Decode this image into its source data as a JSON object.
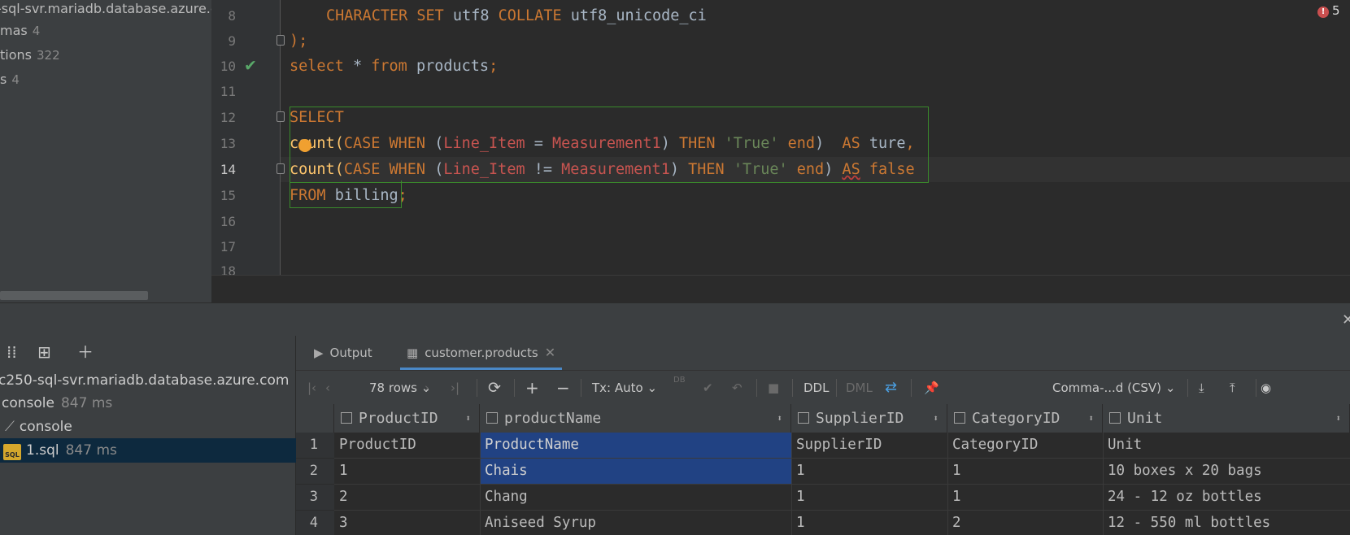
{
  "tree": {
    "items": [
      {
        "label": "-sql-svr.mariadb.database.azure.c",
        "count": ""
      },
      {
        "label": "mas",
        "count": "4"
      },
      {
        "label": "tions",
        "count": "322"
      },
      {
        "label": "s",
        "count": "4"
      }
    ]
  },
  "editor": {
    "error_count": "5",
    "line_numbers": [
      "8",
      "9",
      "10",
      "11",
      "12",
      "13",
      "14",
      "15",
      "16",
      "17",
      "18"
    ],
    "code": {
      "l8_a": "CHARACTER SET",
      "l8_b": " utf8 ",
      "l8_c": "COLLATE",
      "l8_d": " utf8_unicode_ci",
      "l9": ");",
      "l10_a": "select",
      "l10_b": " * ",
      "l10_c": "from",
      "l10_d": " products",
      "l10_e": ";",
      "l12": "SELECT",
      "l13_a": "count(",
      "l13_b": "CASE WHEN",
      "l13_c": " (",
      "l13_d": "Line_Item",
      "l13_e": " = ",
      "l13_f": "Measurement1",
      "l13_g": ") ",
      "l13_h": "THEN",
      "l13_i": " ",
      "l13_j": "'True'",
      "l13_k": " ",
      "l13_l": "end",
      "l13_m": ")  ",
      "l13_n": "AS",
      "l13_o": " ture",
      "l13_p": ",",
      "l14_a": "count(",
      "l14_b": "CASE WHEN",
      "l14_c": " (",
      "l14_d": "Line_Item",
      "l14_e": " != ",
      "l14_f": "Measurement1",
      "l14_g": ") ",
      "l14_h": "THEN",
      "l14_i": " ",
      "l14_j": "'True'",
      "l14_k": " ",
      "l14_l": "end",
      "l14_m": ") ",
      "l14_n": "AS",
      "l14_o": " ",
      "l14_p": "false",
      "l15_a": "FROM",
      "l15_b": " billing",
      "l15_c": ";"
    }
  },
  "services": {
    "rows": [
      {
        "label": "c250-sql-svr.mariadb.database.azure.com",
        "ms": ""
      },
      {
        "label": "console",
        "ms": "847 ms"
      },
      {
        "label": "console",
        "ms": ""
      },
      {
        "label": "1.sql",
        "ms": "847 ms",
        "icon_text": "SQL"
      }
    ]
  },
  "results": {
    "tabs": [
      {
        "label": "Output",
        "icon": "output-icon"
      },
      {
        "label": "customer.products",
        "icon": "table-icon"
      }
    ],
    "toolbar": {
      "rows": "78 rows",
      "tx": "Tx: Auto",
      "ddl": "DDL",
      "dml": "DML",
      "export_format": "Comma-...d (CSV)",
      "db_badge": "DB"
    },
    "columns": [
      "ProductID",
      "productName",
      "SupplierID",
      "CategoryID",
      "Unit"
    ],
    "rows": [
      {
        "n": "1",
        "cells": [
          "ProductID",
          "ProductName",
          "SupplierID",
          "CategoryID",
          "Unit"
        ]
      },
      {
        "n": "2",
        "cells": [
          "1",
          "Chais",
          "1",
          "1",
          "10 boxes x 20 bags"
        ]
      },
      {
        "n": "3",
        "cells": [
          "2",
          "Chang",
          "1",
          "1",
          "24 - 12 oz bottles"
        ]
      },
      {
        "n": "4",
        "cells": [
          "3",
          "Aniseed Syrup",
          "1",
          "2",
          "12 - 550 ml bottles"
        ]
      }
    ]
  }
}
